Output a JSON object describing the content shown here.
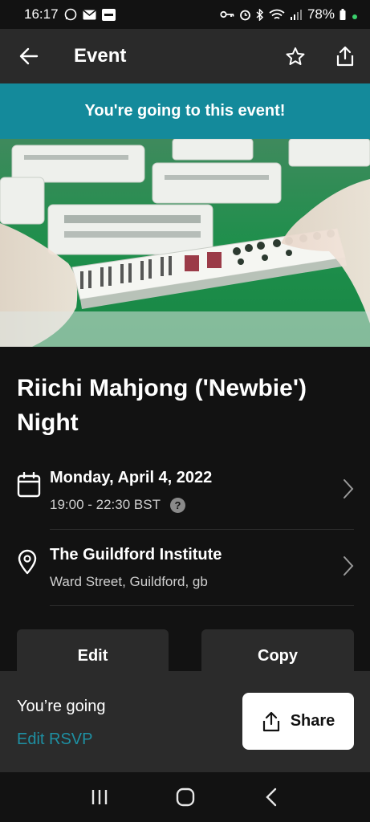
{
  "status_bar": {
    "time": "16:17",
    "battery": "78%"
  },
  "app_bar": {
    "title": "Event"
  },
  "banner": {
    "text": "You're going to this event!"
  },
  "event": {
    "title": "Riichi Mahjong ('Newbie') Night",
    "date": "Monday, April 4, 2022",
    "time": "19:00 - 22:30 BST",
    "help_mark": "?",
    "venue": "The Guildford Institute",
    "address": "Ward Street, Guildford, gb"
  },
  "actions": {
    "edit_label": "Edit",
    "copy_label": "Copy"
  },
  "rsvp": {
    "status": "You’re going",
    "edit_label": "Edit RSVP",
    "share_label": "Share"
  },
  "colors": {
    "banner": "#148a9b",
    "accent_link": "#1e90a3",
    "background": "#121212",
    "app_bar": "#2a2a2a"
  }
}
